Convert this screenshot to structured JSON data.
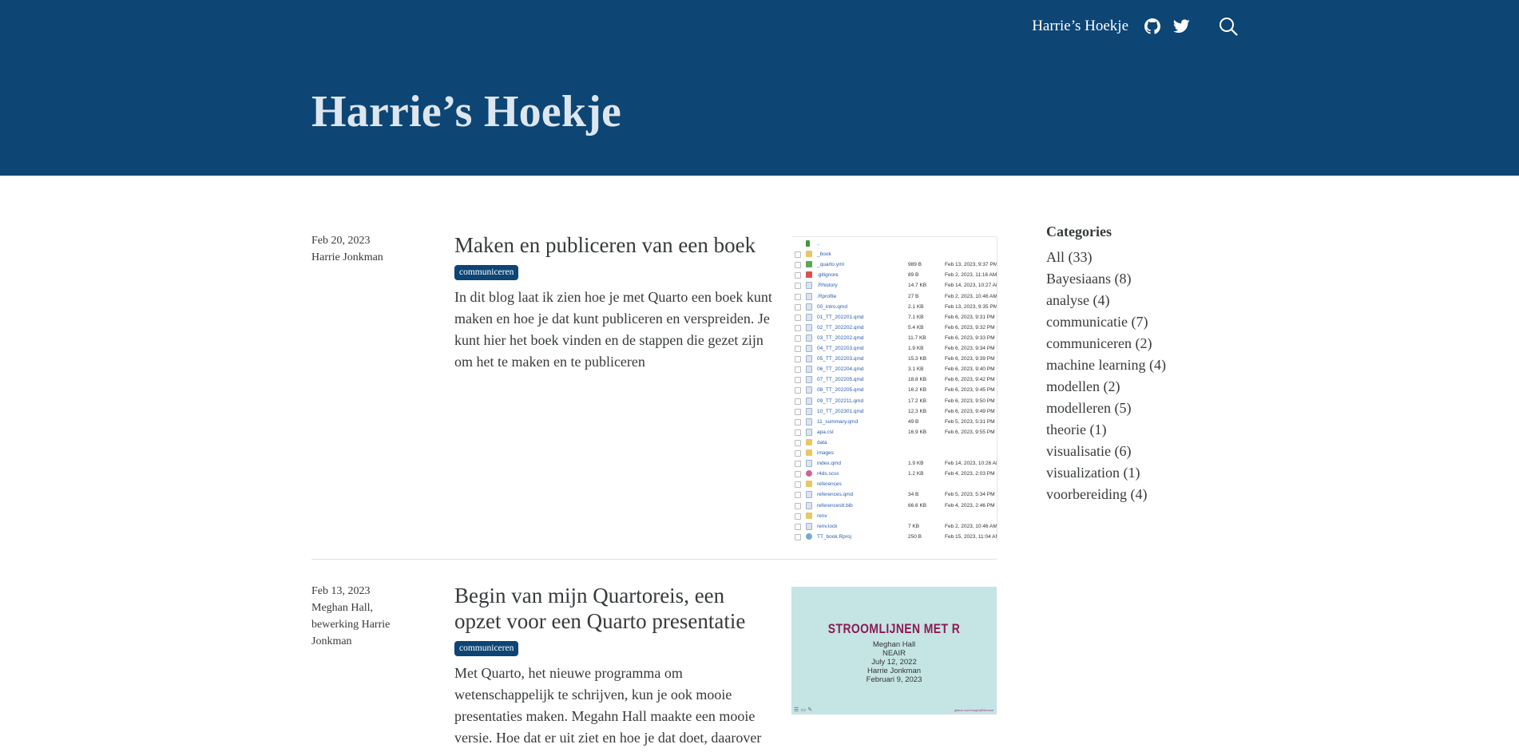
{
  "header": {
    "brand": "Harrie’s Hoekje",
    "page_title": "Harrie’s Hoekje",
    "icons": [
      "github-icon",
      "twitter-icon",
      "search-icon"
    ]
  },
  "posts": [
    {
      "date": "Feb 20, 2023",
      "authors": [
        "Harrie Jonkman"
      ],
      "title": "Maken en publiceren van een boek",
      "category": "communiceren",
      "description": "In dit blog laat ik zien hoe je met Quarto een boek kunt maken en hoe je dat kunt publiceren en verspreiden. Je kunt hier het boek vinden en de stappen die gezet zijn om het te maken en te publiceren",
      "thumbnail_files": [
        {
          "name": "..",
          "size": "",
          "date": ""
        },
        {
          "name": "_book",
          "size": "",
          "date": ""
        },
        {
          "name": "_quarto.yml",
          "size": "989 B",
          "date": "Feb 13, 2023, 9:37 PM"
        },
        {
          "name": ".gitignore",
          "size": "89 B",
          "date": "Feb 2, 2023, 11:16 AM"
        },
        {
          "name": ".Rhistory",
          "size": "14.7 KB",
          "date": "Feb 14, 2023, 10:27 AM"
        },
        {
          "name": ".Rprofile",
          "size": "27 B",
          "date": "Feb 2, 2023, 10:46 AM"
        },
        {
          "name": "00_intro.qmd",
          "size": "2.1 KB",
          "date": "Feb 13, 2023, 9:35 PM"
        },
        {
          "name": "01_TT_202201.qmd",
          "size": "7.1 KB",
          "date": "Feb 6, 2023, 9:31 PM"
        },
        {
          "name": "02_TT_202202.qmd",
          "size": "5.4 KB",
          "date": "Feb 6, 2023, 9:32 PM"
        },
        {
          "name": "03_TT_202202.qmd",
          "size": "11.7 KB",
          "date": "Feb 6, 2023, 9:33 PM"
        },
        {
          "name": "04_TT_202203.qmd",
          "size": "1.9 KB",
          "date": "Feb 6, 2023, 9:34 PM"
        },
        {
          "name": "05_TT_202203.qmd",
          "size": "15.3 KB",
          "date": "Feb 6, 2023, 9:39 PM"
        },
        {
          "name": "06_TT_202204.qmd",
          "size": "3.1 KB",
          "date": "Feb 6, 2023, 9:40 PM"
        },
        {
          "name": "07_TT_202205.qmd",
          "size": "18.8 KB",
          "date": "Feb 6, 2023, 9:42 PM"
        },
        {
          "name": "08_TT_202205.qmd",
          "size": "16.2 KB",
          "date": "Feb 6, 2023, 9:45 PM"
        },
        {
          "name": "09_TT_202211.qmd",
          "size": "17.2 KB",
          "date": "Feb 6, 2023, 9:50 PM"
        },
        {
          "name": "10_TT_202301.qmd",
          "size": "12.3 KB",
          "date": "Feb 6, 2023, 9:49 PM"
        },
        {
          "name": "11_summary.qmd",
          "size": "49 B",
          "date": "Feb 5, 2023, 5:31 PM"
        },
        {
          "name": "apa.csl",
          "size": "16.9 KB",
          "date": "Feb 6, 2023, 9:55 PM"
        },
        {
          "name": "data",
          "size": "",
          "date": ""
        },
        {
          "name": "images",
          "size": "",
          "date": ""
        },
        {
          "name": "index.qmd",
          "size": "1.9 KB",
          "date": "Feb 14, 2023, 10:26 AM"
        },
        {
          "name": "r4ds.scss",
          "size": "1.2 KB",
          "date": "Feb 4, 2023, 2:03 PM"
        },
        {
          "name": "references",
          "size": "",
          "date": ""
        },
        {
          "name": "references.qmd",
          "size": "34 B",
          "date": "Feb 5, 2023, 5:34 PM"
        },
        {
          "name": "referencestt.bib",
          "size": "66.6 KB",
          "date": "Feb 4, 2023, 2:46 PM"
        },
        {
          "name": "renv",
          "size": "",
          "date": ""
        },
        {
          "name": "renv.lock",
          "size": "7 KB",
          "date": "Feb 2, 2023, 10:46 AM"
        },
        {
          "name": "TT_book.Rproj",
          "size": "250 B",
          "date": "Feb 15, 2023, 11:04 AM"
        }
      ]
    },
    {
      "date": "Feb 13, 2023",
      "authors": [
        "Meghan Hall,",
        "bewerking Harrie",
        "Jonkman"
      ],
      "title": "Begin van mijn Quartoreis, een opzet voor een Quarto presentatie",
      "category": "communiceren",
      "description": "Met Quarto, het nieuwe programma om wetenschappelijk te schrijven, kun je ook mooie presentaties maken. Megahn Hall maakte een mooie versie. Hoe dat er uit ziet en hoe je dat doet, daarover",
      "thumbnail_slide": {
        "title": "STROOMLIJNEN MET R",
        "lines": [
          "Meghan Hall",
          "NEAIR",
          "July 12, 2022",
          "Harrie Jonkman",
          "Februari 9, 2023"
        ],
        "footer": "github.com/meghall06/neair"
      }
    }
  ],
  "sidebar": {
    "heading": "Categories",
    "categories": [
      "All (33)",
      "Bayesiaans (8)",
      "analyse (4)",
      "communicatie (7)",
      "communiceren (2)",
      "machine learning (4)",
      "modellen (2)",
      "modelleren (5)",
      "theorie (1)",
      "visualisatie (6)",
      "visualization (1)",
      "voorbereiding (4)"
    ]
  },
  "colors": {
    "navbar": "#0d4575",
    "badge": "#0d4575",
    "title_text": "#dde6ee",
    "body_text": "#373a3c",
    "slide_bg": "#c5e4e4",
    "slide_title": "#8a1a55"
  }
}
